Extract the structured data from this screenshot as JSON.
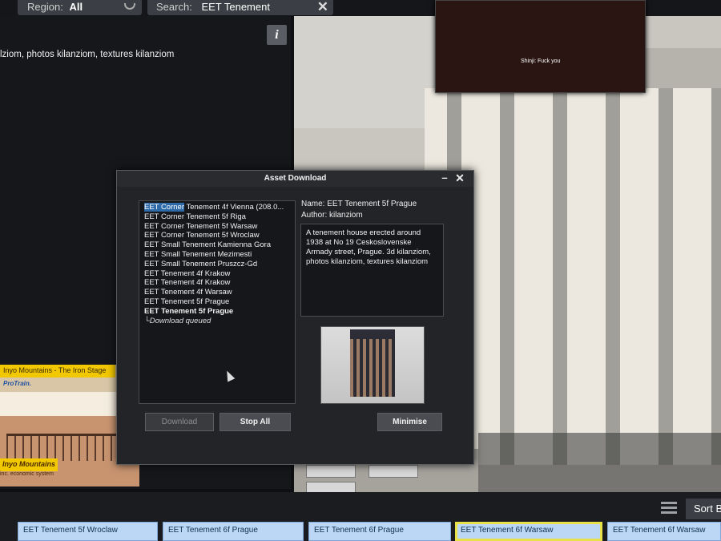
{
  "topbar": {
    "region_label": "Region:",
    "region_value": "All",
    "search_label": "Search:",
    "search_value": "EET Tenement"
  },
  "left_panel": {
    "info_icon": "info-icon",
    "description_snippet": "lziom, photos kilanziom, textures kilanziom"
  },
  "chat_popup": {
    "message": "Shinji: Fuck you"
  },
  "ad": {
    "title": "Inyo Mountains - The Iron Stage",
    "logo": "ProTrain.",
    "badge": "Inyo Mountains",
    "subtitle": "inc. economic system"
  },
  "dialog": {
    "title": "Asset Download",
    "minimize_icon": "minimize-icon",
    "close_icon": "close-icon",
    "list_first_highlight": "EET Corner",
    "list_first_rest": " Tenement 4f Vienna (208.0...",
    "list_items": [
      "EET Corner Tenement 5f Riga",
      "EET Corner Tenement 5f Warsaw",
      "EET Corner Tenement 5f Wroclaw",
      "EET Small Tenement Kamienna Gora",
      "EET Small Tenement Mezimesti",
      "EET Small Tenement Pruszcz-Gd",
      "EET Tenement 4f Krakow",
      "EET Tenement 4f Krakow",
      "EET Tenement 4f Warsaw",
      "EET Tenement 5f Prague"
    ],
    "list_last_bold": "EET Tenement 5f Prague",
    "list_status": "└Download queued",
    "name_line": "Name: EET Tenement 5f Prague",
    "author_line": "Author: kilanziom",
    "description": "A tenement house erected around 1938 at No 19 Ceskoslovenske Armady street, Prague. 3d kilanziom, photos kilanziom, textures kilanziom",
    "download_label": "Download",
    "stop_all_label": "Stop All",
    "minimise_label": "Minimise"
  },
  "bottom": {
    "sort_label": "Sort B",
    "tiles": [
      "EET Tenement 5f Wroclaw",
      "EET Tenement 6f Prague",
      "EET Tenement 6f Prague",
      "EET Tenement 6f Warsaw",
      "EET Tenement 6f Warsaw"
    ]
  }
}
